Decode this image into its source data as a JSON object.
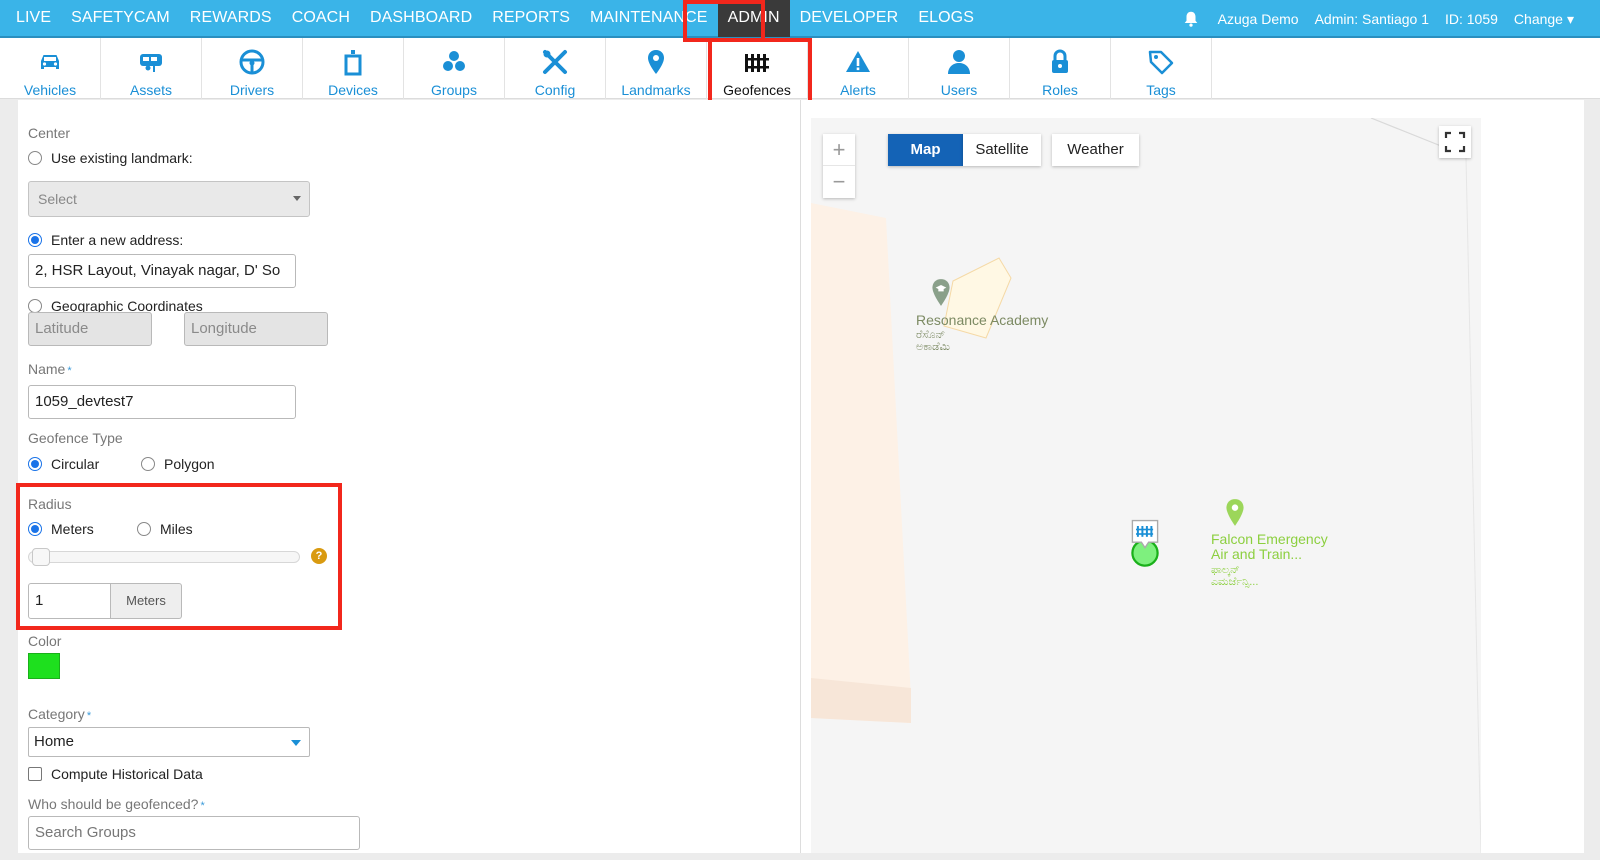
{
  "topnav": {
    "items": [
      {
        "label": "LIVE"
      },
      {
        "label": "SAFETYCAM"
      },
      {
        "label": "REWARDS"
      },
      {
        "label": "COACH"
      },
      {
        "label": "DASHBOARD"
      },
      {
        "label": "REPORTS"
      },
      {
        "label": "MAINTENANCE"
      },
      {
        "label": "ADMIN"
      },
      {
        "label": "DEVELOPER"
      },
      {
        "label": "ELOGS"
      }
    ],
    "active": "ADMIN",
    "account": "Azuga Demo",
    "user": "Admin: Santiago 1",
    "id": "ID: 1059",
    "change": "Change"
  },
  "subnav": {
    "tabs": [
      {
        "label": "Vehicles",
        "icon": "car-icon"
      },
      {
        "label": "Assets",
        "icon": "trailer-icon"
      },
      {
        "label": "Drivers",
        "icon": "steering-wheel-icon"
      },
      {
        "label": "Devices",
        "icon": "device-icon"
      },
      {
        "label": "Groups",
        "icon": "groups-icon"
      },
      {
        "label": "Config",
        "icon": "tools-icon"
      },
      {
        "label": "Landmarks",
        "icon": "pin-icon"
      },
      {
        "label": "Geofences",
        "icon": "fence-icon"
      },
      {
        "label": "Alerts",
        "icon": "warning-icon"
      },
      {
        "label": "Users",
        "icon": "user-icon"
      },
      {
        "label": "Roles",
        "icon": "lock-icon"
      },
      {
        "label": "Tags",
        "icon": "tag-icon"
      }
    ],
    "active": "Geofences"
  },
  "form": {
    "center_label": "Center",
    "use_existing": "Use existing landmark:",
    "landmark_select": "Select",
    "enter_address": "Enter a new address:",
    "address_value": "2, HSR Layout, Vinayak nagar, D' So",
    "geo_coords": "Geographic Coordinates",
    "latitude_placeholder": "Latitude",
    "longitude_placeholder": "Longitude",
    "name_label": "Name",
    "name_value": "1059_devtest7",
    "type_label": "Geofence Type",
    "type_circular": "Circular",
    "type_polygon": "Polygon",
    "radius_label": "Radius",
    "unit_meters": "Meters",
    "unit_miles": "Miles",
    "radius_value": "1",
    "radius_unit_button": "Meters",
    "help": "?",
    "color_label": "Color",
    "color_value": "#1ee01e",
    "category_label": "Category",
    "category_value": "Home",
    "compute_historical": "Compute Historical Data",
    "who_label": "Who should be geofenced?",
    "search_groups_placeholder": "Search Groups",
    "required_mark": "*"
  },
  "map": {
    "zoom_in": "+",
    "zoom_out": "−",
    "types": [
      "Map",
      "Satellite"
    ],
    "active_type": "Map",
    "weather": "Weather",
    "places": [
      {
        "name": "Resonance Academy",
        "local": "ರೆಸೊನ್ ಅಕಾಡೆಮಿ"
      },
      {
        "name_line1": "Falcon Emergency",
        "name_line2": "Air and Train...",
        "local_line1": "ಫಾಲ್ಕನ್",
        "local_line2": "ಎಮರ್ಜೆನ್ಸಿ..."
      }
    ]
  }
}
